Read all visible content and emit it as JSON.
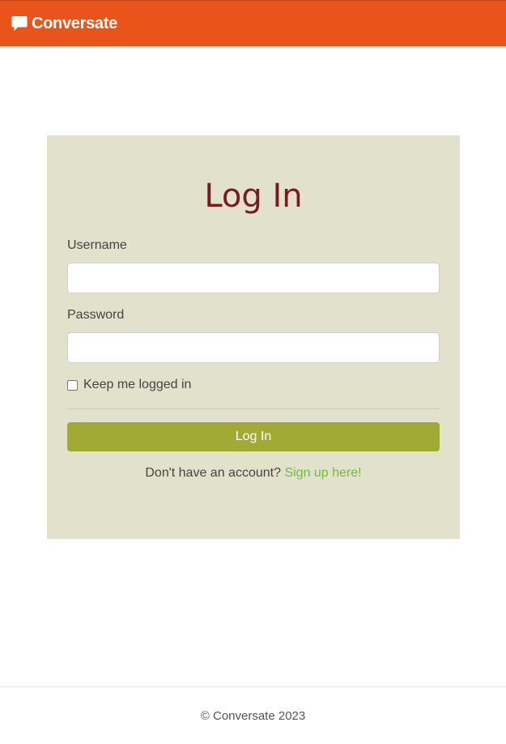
{
  "brand": {
    "name": "Conversate",
    "icon": "speech-bubble-icon"
  },
  "login": {
    "title": "Log In",
    "username_label": "Username",
    "username_value": "",
    "password_label": "Password",
    "password_value": "",
    "remember_label": "Keep me logged in",
    "remember_checked": false,
    "submit_label": "Log In",
    "signup_prompt": "Don't have an account?",
    "signup_link": "Sign up here!"
  },
  "footer": {
    "copyright": "© Conversate 2023"
  },
  "colors": {
    "navbar": "#e8541a",
    "card": "#e1e1cc",
    "title": "#7a1a1f",
    "button": "#a1ab34",
    "link": "#6fbd3a"
  }
}
